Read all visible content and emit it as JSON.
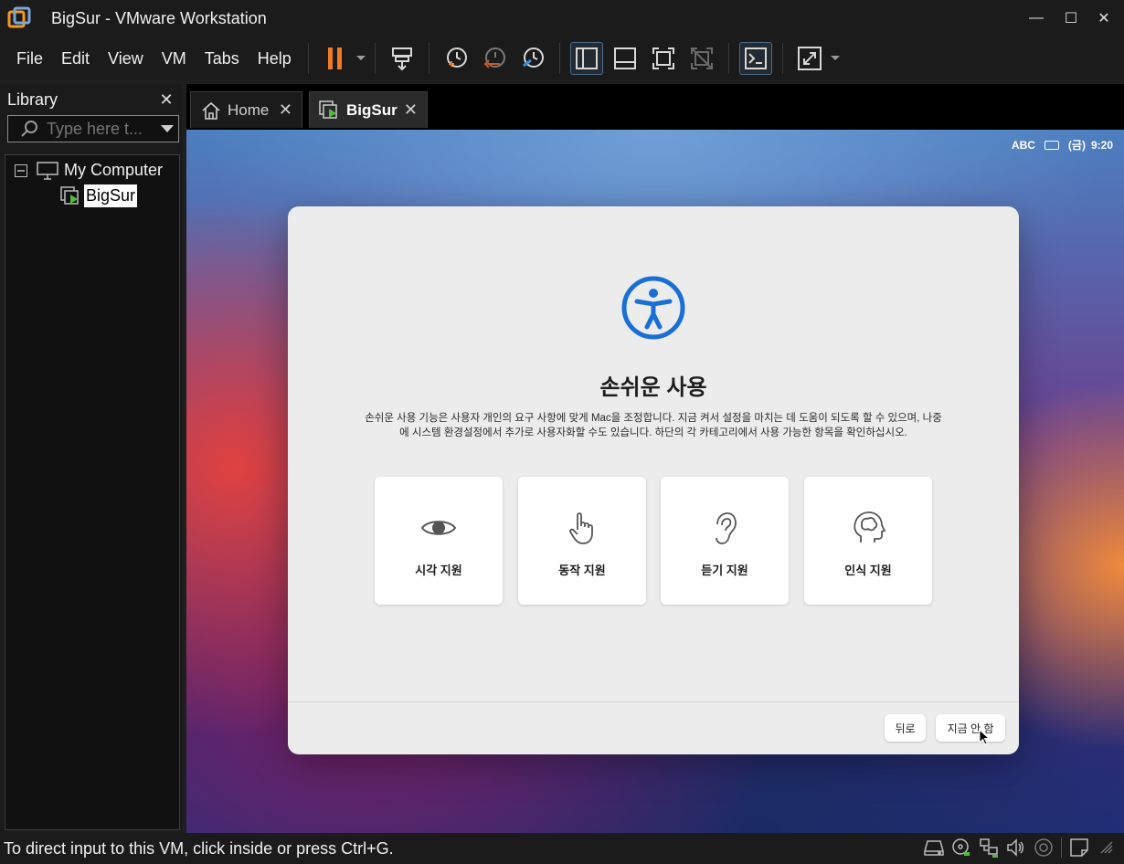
{
  "window": {
    "title": "BigSur - VMware Workstation"
  },
  "menu": {
    "items": [
      "File",
      "Edit",
      "View",
      "VM",
      "Tabs",
      "Help"
    ]
  },
  "library": {
    "title": "Library",
    "search_placeholder": "Type here t...",
    "tree": {
      "root": "My Computer",
      "vm": "BigSur"
    }
  },
  "tabs": [
    {
      "label": "Home",
      "active": false
    },
    {
      "label": "BigSur",
      "active": true
    }
  ],
  "vm": {
    "status_bar": {
      "input_source": "ABC",
      "date": "(금)",
      "time": "9:20"
    },
    "dialog": {
      "title": "손쉬운 사용",
      "description": "손쉬운 사용 기능은 사용자 개인의 요구 사항에 맞게 Mac을 조정합니다. 지금 켜서 설정을 마치는 데 도움이 되도록 할 수 있으며, 나중에 시스템 환경설정에서 추가로 사용자화할 수도 있습니다. 하단의 각 카테고리에서 사용 가능한 항목을 확인하십시오.",
      "categories": [
        {
          "label": "시각 지원",
          "icon": "eye-icon"
        },
        {
          "label": "동작 지원",
          "icon": "hand-pointer-icon"
        },
        {
          "label": "듣기 지원",
          "icon": "ear-icon"
        },
        {
          "label": "인식 지원",
          "icon": "head-brain-icon"
        }
      ],
      "back_label": "뒤로",
      "skip_label": "지금 안 함"
    }
  },
  "status": {
    "message": "To direct input to this VM, click inside or press Ctrl+G."
  },
  "colors": {
    "accent_blue": "#1a6fd6",
    "pause_orange": "#f07a28",
    "chrome_bg": "#1b1b1b"
  }
}
